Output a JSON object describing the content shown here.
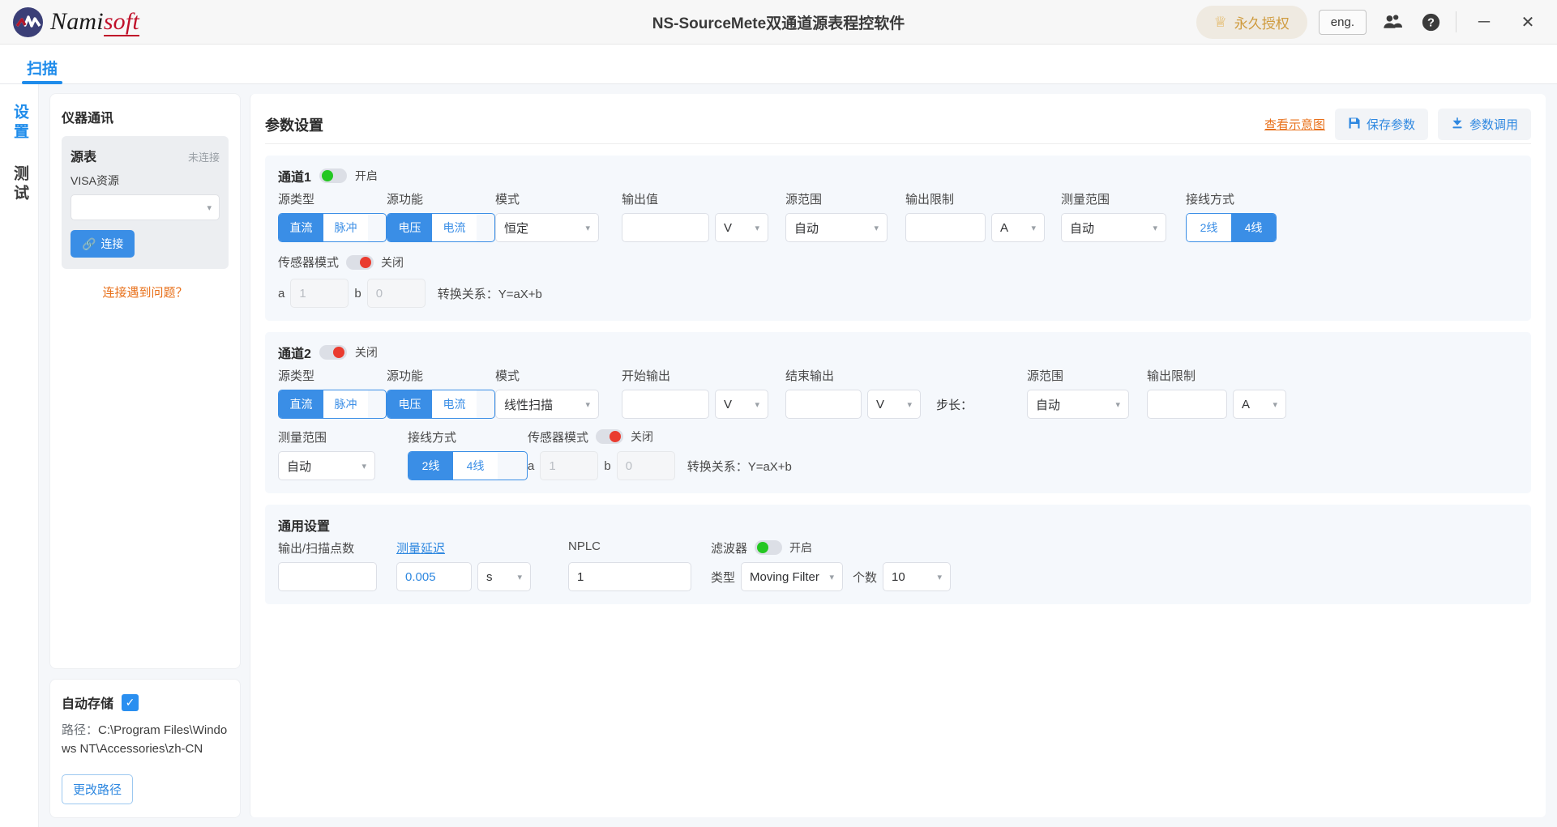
{
  "titlebar": {
    "brand_name": "Nami",
    "brand_accent": "soft",
    "app_title": "NS-SourceMete双通道源表程控软件",
    "license_label": "永久授权",
    "crown_icon": "crown-icon",
    "lang_label": "eng.",
    "users_icon": "users-icon",
    "help_icon": "help-icon",
    "minimize_label": "─",
    "close_label": "✕"
  },
  "tabs": [
    {
      "label": "扫描",
      "active": true
    }
  ],
  "vnav": [
    {
      "label": "设置",
      "active": true
    },
    {
      "label": "测试",
      "active": false
    }
  ],
  "instrument": {
    "card_title": "仪器通讯",
    "source_label": "源表",
    "status": "未连接",
    "visa_label": "VISA资源",
    "visa_value": "",
    "connect_label": "连接",
    "link_icon": "link-icon",
    "help_link": "连接遇到问题？"
  },
  "autosave": {
    "title": "自动存储",
    "checked": true,
    "check_icon": "check-icon",
    "path_label": "路径：",
    "path_value": "C:\\Program Files\\Windows NT\\Accessories\\zh-CN",
    "change_path_label": "更改路径"
  },
  "main": {
    "title": "参数设置",
    "view_diagram_label": "查看示意图",
    "save_params_label": "保存参数",
    "save_icon": "floppy-disk-icon",
    "load_params_label": "参数调用",
    "load_icon": "download-icon"
  },
  "channel1": {
    "title": "通道1",
    "switch_state": "on",
    "switch_text": "开启",
    "source_type": {
      "label": "源类型",
      "options": [
        "直流",
        "脉冲"
      ],
      "selected": "直流"
    },
    "source_function": {
      "label": "源功能",
      "options": [
        "电压",
        "电流"
      ],
      "selected": "电压"
    },
    "mode": {
      "label": "模式",
      "value": "恒定"
    },
    "output_value": {
      "label": "输出值",
      "value": "",
      "unit": "V"
    },
    "source_range": {
      "label": "源范围",
      "value": "自动"
    },
    "output_limit": {
      "label": "输出限制",
      "value": "",
      "unit": "A"
    },
    "measure_range": {
      "label": "测量范围",
      "value": "自动"
    },
    "wiring": {
      "label": "接线方式",
      "options": [
        "2线",
        "4线"
      ],
      "selected": "4线"
    },
    "sensor": {
      "label": "传感器模式",
      "switch_state": "off",
      "switch_text": "关闭",
      "a_label": "a",
      "a_value": "1",
      "b_label": "b",
      "b_value": "0",
      "formula": "转换关系：Y=aX+b"
    }
  },
  "channel2": {
    "title": "通道2",
    "switch_state": "off",
    "switch_text": "关闭",
    "source_type": {
      "label": "源类型",
      "options": [
        "直流",
        "脉冲"
      ],
      "selected": "直流"
    },
    "source_function": {
      "label": "源功能",
      "options": [
        "电压",
        "电流"
      ],
      "selected": "电压"
    },
    "mode": {
      "label": "模式",
      "value": "线性扫描"
    },
    "start_output": {
      "label": "开始输出",
      "value": "",
      "unit": "V"
    },
    "end_output": {
      "label": "结束输出",
      "value": "",
      "unit": "V"
    },
    "step_label": "步长：",
    "source_range": {
      "label": "源范围",
      "value": "自动"
    },
    "output_limit": {
      "label": "输出限制",
      "value": "",
      "unit": "A"
    },
    "measure_range": {
      "label": "测量范围",
      "value": "自动"
    },
    "wiring": {
      "label": "接线方式",
      "options": [
        "2线",
        "4线"
      ],
      "selected": "2线"
    },
    "sensor": {
      "label": "传感器模式",
      "switch_state": "off",
      "switch_text": "关闭",
      "a_label": "a",
      "a_value": "1",
      "b_label": "b",
      "b_value": "0",
      "formula": "转换关系：Y=aX+b"
    }
  },
  "general": {
    "title": "通用设置",
    "points": {
      "label": "输出/扫描点数",
      "value": ""
    },
    "delay": {
      "label": "测量延迟",
      "value": "0.005",
      "unit": "s"
    },
    "nplc": {
      "label": "NPLC",
      "value": "1"
    },
    "filter": {
      "label": "滤波器",
      "switch_state": "on",
      "switch_text": "开启",
      "type_label": "类型",
      "type_value": "Moving Filter",
      "count_label": "个数",
      "count_value": "10"
    }
  }
}
